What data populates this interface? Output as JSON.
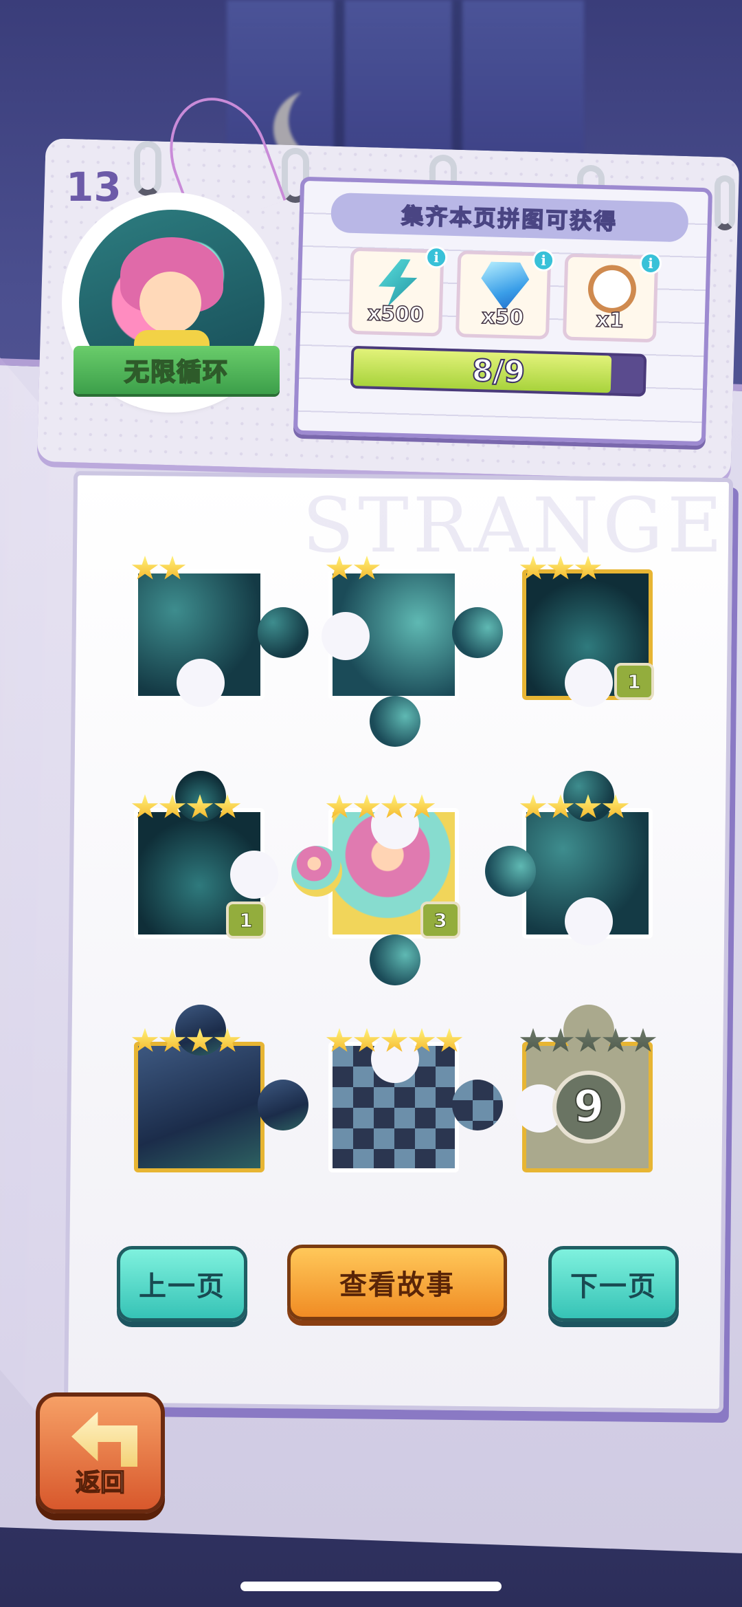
{
  "page_number": "13",
  "character": {
    "name": "无限循环"
  },
  "rewards": {
    "title": "集齐本页拼图可获得",
    "items": [
      {
        "icon": "energy-bolt-icon",
        "count": "x500"
      },
      {
        "icon": "diamond-icon",
        "count": "x50"
      },
      {
        "icon": "pocket-watch-icon",
        "count": "x1"
      }
    ],
    "info_glyph": "i",
    "progress": {
      "collected": 8,
      "total": 9,
      "label": "8/9"
    }
  },
  "watermark": "STRANGE",
  "pieces": [
    {
      "id": 1,
      "stars": 2,
      "count": ""
    },
    {
      "id": 2,
      "stars": 2,
      "count": ""
    },
    {
      "id": 3,
      "stars": 3,
      "count": "1"
    },
    {
      "id": 4,
      "stars": 4,
      "count": "1"
    },
    {
      "id": 5,
      "stars": 4,
      "count": "3"
    },
    {
      "id": 6,
      "stars": 4,
      "count": ""
    },
    {
      "id": 7,
      "stars": 4,
      "count": ""
    },
    {
      "id": 8,
      "stars": 5,
      "count": ""
    },
    {
      "id": 9,
      "stars": 5,
      "locked": true,
      "number": "9"
    }
  ],
  "buttons": {
    "prev": "上一页",
    "story": "查看故事",
    "next": "下一页",
    "back": "返回"
  },
  "colors": {
    "accent_teal": "#36c3b6",
    "accent_orange": "#f08c24",
    "progress_fill": "#a8d33c",
    "star_gold": "#f4b428"
  }
}
